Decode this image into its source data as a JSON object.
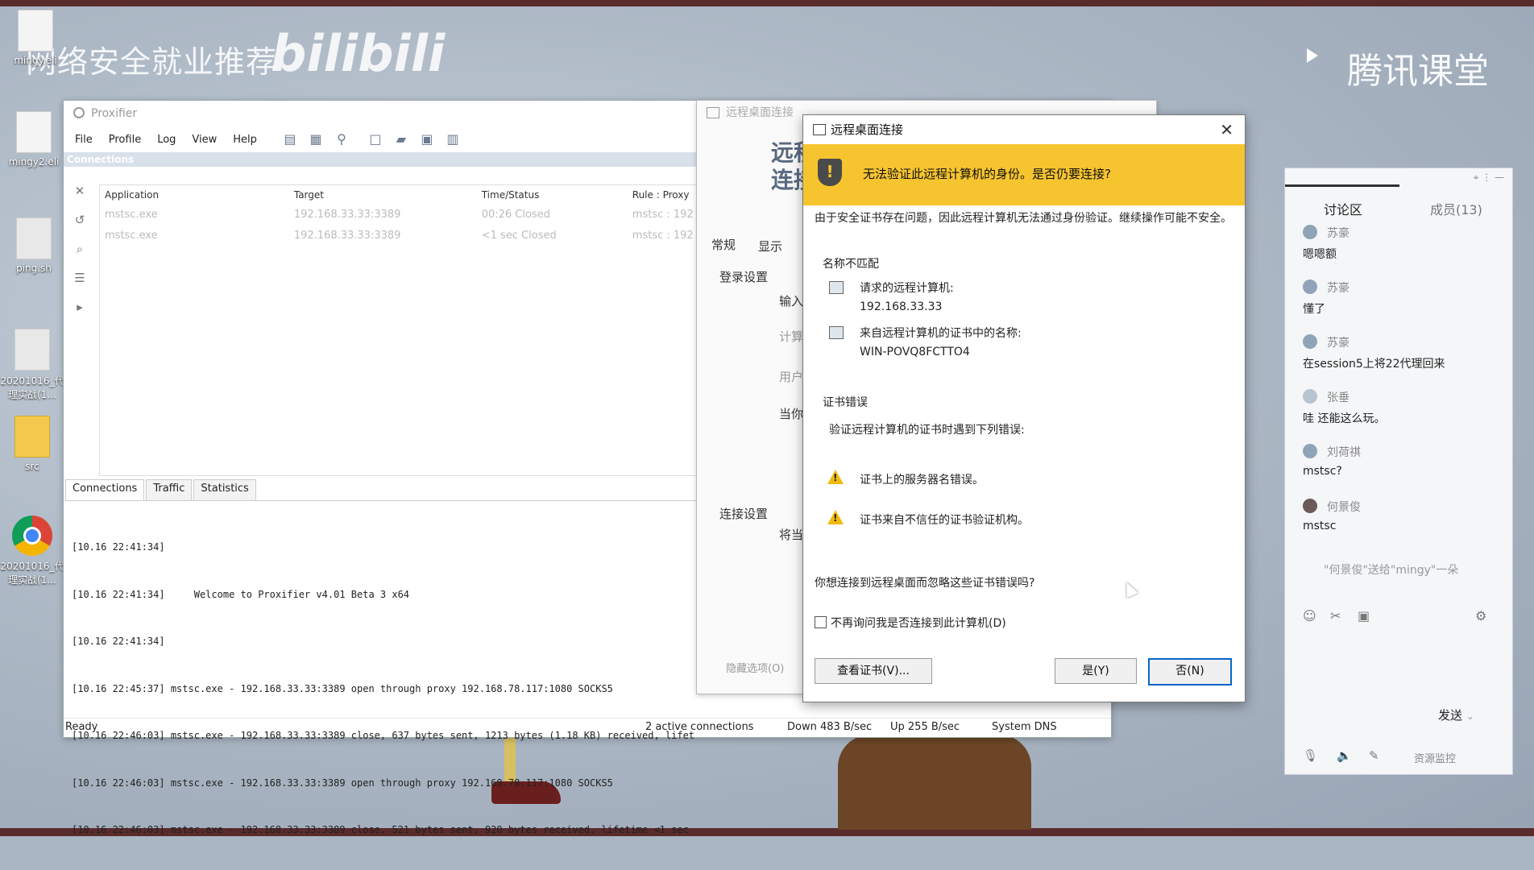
{
  "watermarks": {
    "left_text": "网络安全就业推荐",
    "bili": "bilibili",
    "right_text": "腾讯课堂"
  },
  "desktop_icons": [
    {
      "label": "mingy.eli"
    },
    {
      "label": "mingy2.eli"
    },
    {
      "label": "ping.sh"
    },
    {
      "label": "20201016_代理实战(1..."
    },
    {
      "label": "src"
    },
    {
      "label": "20201016_代理实战(1..."
    }
  ],
  "proxifier": {
    "title": "Proxifier",
    "menu": [
      "File",
      "Profile",
      "Log",
      "View",
      "Help"
    ],
    "connections_header": "Connections",
    "columns": [
      "Application",
      "Target",
      "Time/Status",
      "Rule : Proxy"
    ],
    "rows": [
      {
        "app": "mstsc.exe",
        "target": "192.168.33.33:3389",
        "time": "00:26 Closed",
        "rule": "mstsc : 192"
      },
      {
        "app": "mstsc.exe",
        "target": "192.168.33.33:3389",
        "time": "<1 sec Closed",
        "rule": "mstsc : 192"
      }
    ],
    "tabs": [
      "Connections",
      "Traffic",
      "Statistics"
    ],
    "log": [
      "[10.16 22:41:34]",
      "[10.16 22:41:34]     Welcome to Proxifier v4.01 Beta 3 x64",
      "[10.16 22:41:34]",
      "[10.16 22:45:37] mstsc.exe - 192.168.33.33:3389 open through proxy 192.168.78.117:1080 SOCKS5",
      "[10.16 22:46:03] mstsc.exe - 192.168.33.33:3389 close, 637 bytes sent, 1213 bytes (1.18 KB) received, lifet",
      "[10.16 22:46:03] mstsc.exe - 192.168.33.33:3389 open through proxy 192.168.78.117:1080 SOCKS5",
      "[10.16 22:46:03] mstsc.exe - 192.168.33.33:3389 close, 521 bytes sent, 920 bytes received, lifetime <1 sec"
    ],
    "status": {
      "ready": "Ready",
      "active": "2 active connections",
      "down": "Down 483 B/sec",
      "up": "Up 255 B/sec",
      "dns": "System DNS"
    }
  },
  "rdp_back": {
    "title": "远程桌面连接",
    "heading1": "远程",
    "heading2": "连接",
    "tab_general": "常规",
    "tab_display": "显示",
    "login_settings": "登录设置",
    "input": "输入",
    "computer": "计算",
    "user": "用户",
    "current": "当你",
    "conn_settings": "连接设置",
    "save": "将当",
    "hide_options": "隐藏选项(O)"
  },
  "dialog": {
    "title": "远程桌面连接",
    "banner": "无法验证此远程计算机的身份。是否仍要连接?",
    "intro": "由于安全证书存在问题，因此远程计算机无法通过身份验证。继续操作可能不安全。",
    "name_mismatch": "名称不匹配",
    "requested_label": "请求的远程计算机:",
    "requested_value": "192.168.33.33",
    "cert_name_label": "来自远程计算机的证书中的名称:",
    "cert_name_value": "WIN-POVQ8FCTTO4",
    "cert_errors": "证书错误",
    "cert_errors_desc": "验证远程计算机的证书时遇到下列错误:",
    "error1": "证书上的服务器名错误。",
    "error2": "证书来自不信任的证书验证机构。",
    "question": "你想连接到远程桌面而忽略这些证书错误吗?",
    "dont_ask": "不再询问我是否连接到此计算机(D)",
    "view_cert": "查看证书(V)...",
    "yes": "是(Y)",
    "no": "否(N)"
  },
  "chat": {
    "header": "讨论区",
    "members": "成员(13)",
    "messages": [
      {
        "name": "苏豪",
        "text": "嗯嗯额"
      },
      {
        "name": "苏豪",
        "text": "懂了"
      },
      {
        "name": "苏豪",
        "text": "在session5上将22代理回来"
      },
      {
        "name": "张垂",
        "text": "哇 还能这么玩。"
      },
      {
        "name": "刘荷祺",
        "text": "mstsc?"
      },
      {
        "name": "何景俊",
        "text": "mstsc"
      }
    ],
    "gift": "\"何景俊\"送给\"mingy\"一朵",
    "send": "发送",
    "resource": "资源监控"
  }
}
